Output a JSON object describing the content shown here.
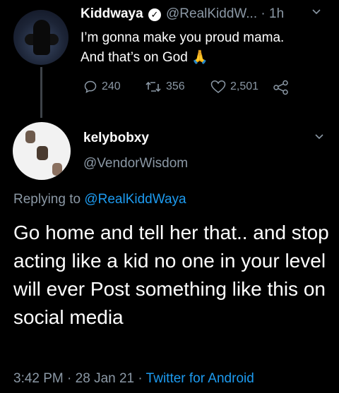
{
  "parent_tweet": {
    "display_name": "Kiddwaya",
    "handle": "@RealKiddW...",
    "time": "· 1h",
    "text_line1": "I’m gonna make you proud mama.",
    "text_line2": "And that’s on God",
    "emoji": "🙏",
    "reply_count": "240",
    "retweet_count": "356",
    "like_count": "2,501"
  },
  "reply_tweet": {
    "display_name": "kelybobxy",
    "handle": "@VendorWisdom",
    "replying_prefix": "Replying to",
    "replying_handle": "@RealKiddWaya",
    "body": "Go home and tell her that.. and stop acting like a kid no one in your level will ever Post something like this on social media",
    "time": "3:42 PM",
    "date": "28 Jan 21",
    "separator": "·",
    "source": "Twitter for Android"
  },
  "colors": {
    "background": "#000000",
    "text": "#ffffff",
    "muted": "#8b98a5",
    "link": "#1d9bf0"
  }
}
